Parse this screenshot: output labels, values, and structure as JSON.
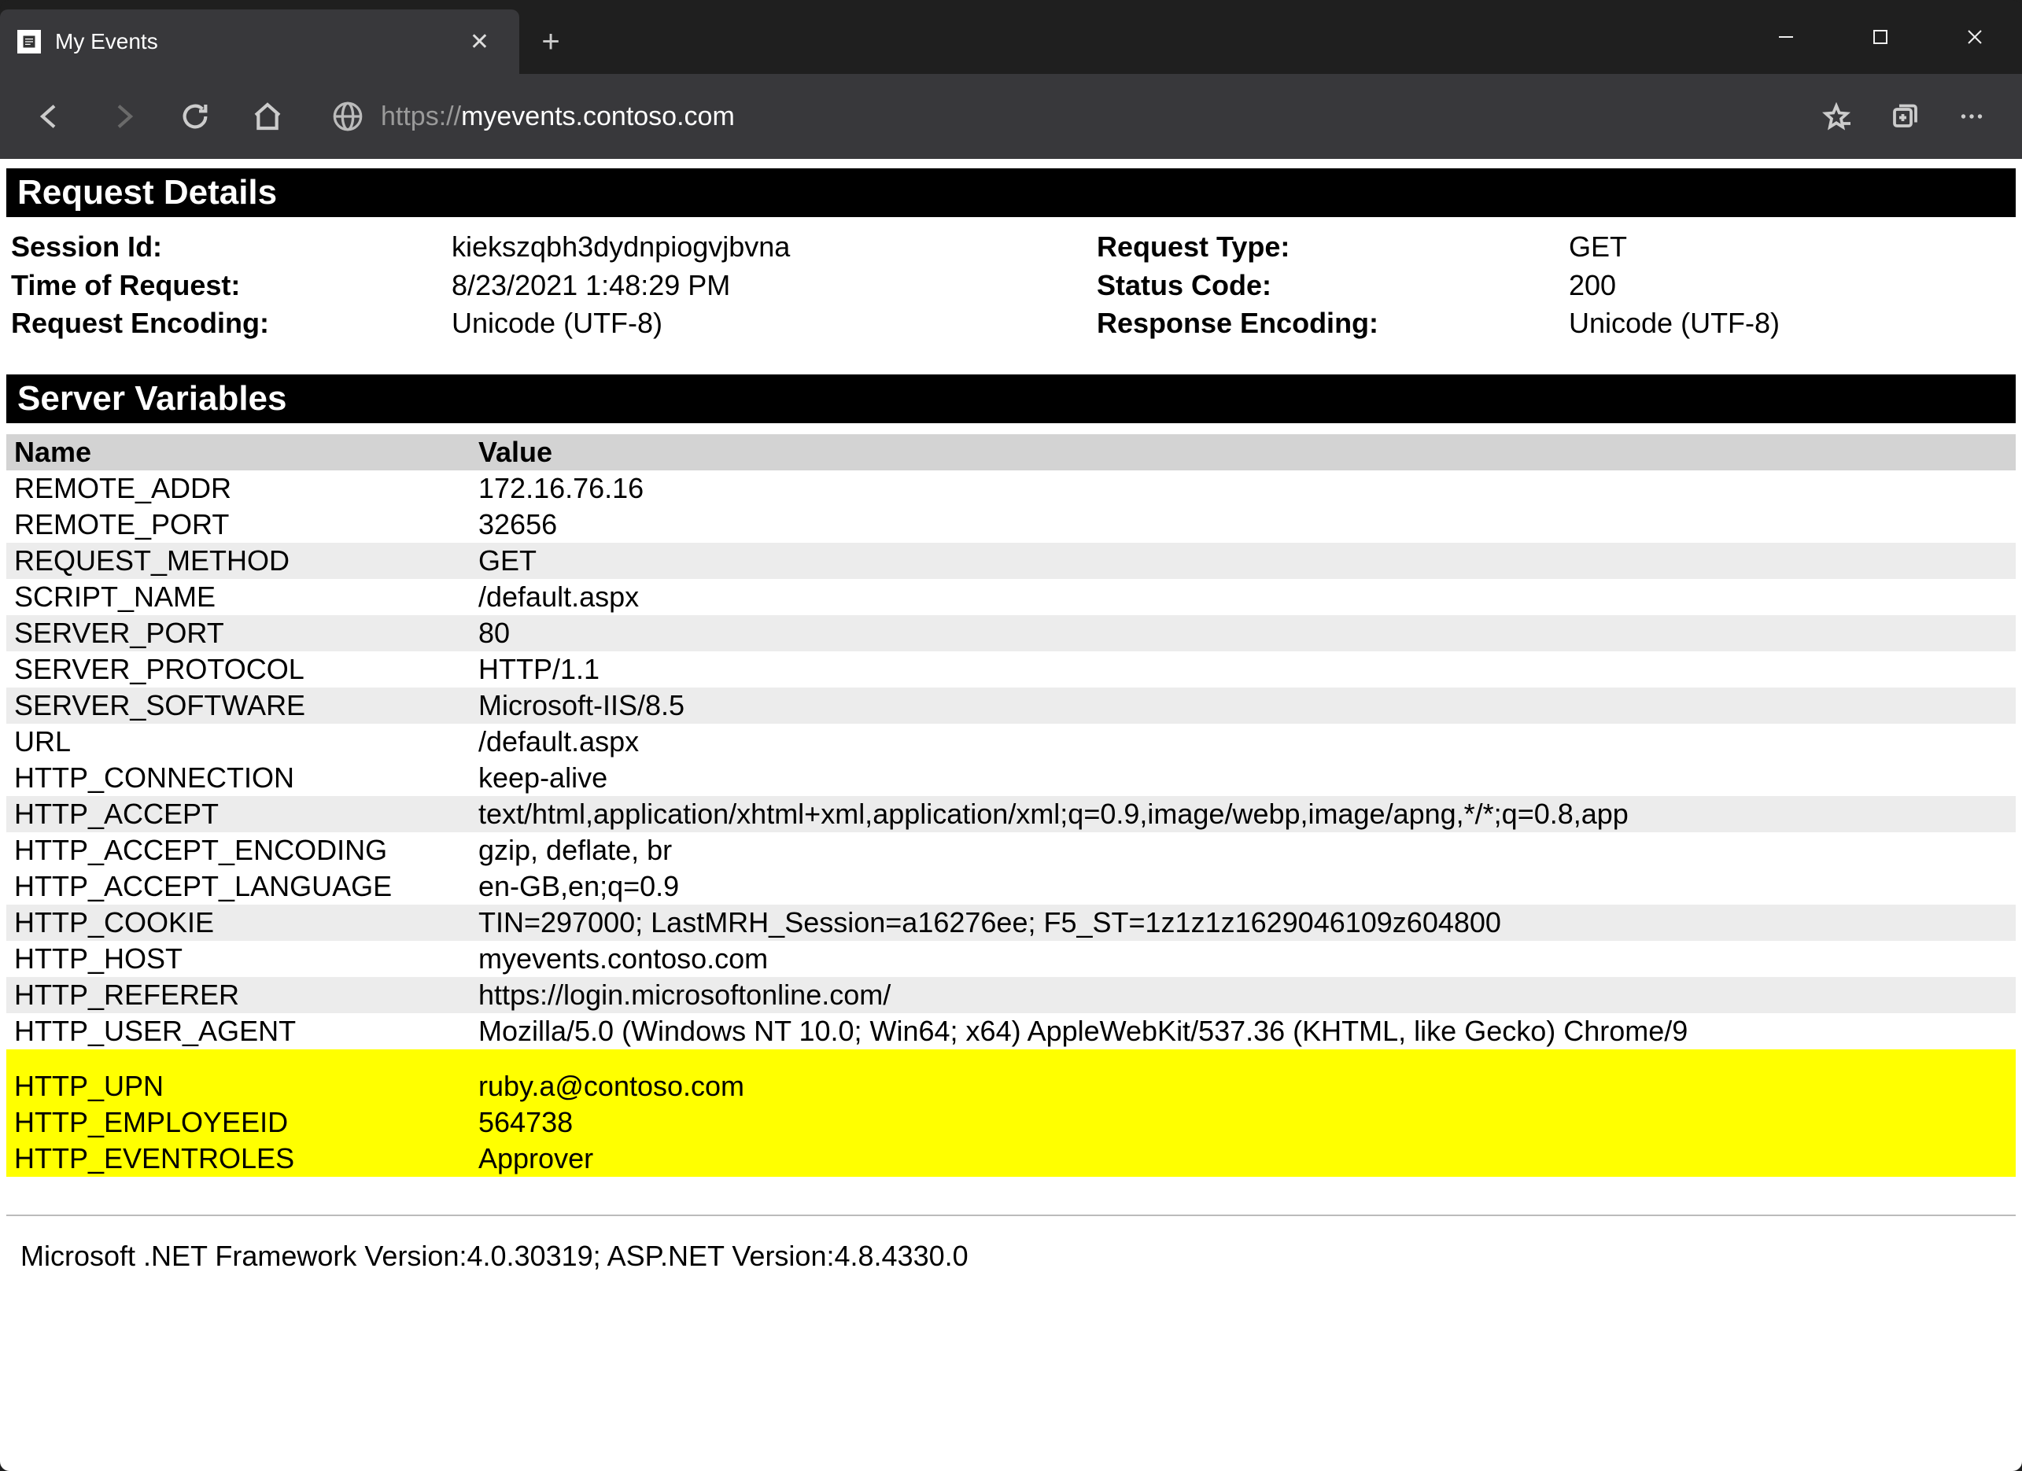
{
  "browser": {
    "tab_title": "My Events",
    "url_proto": "https://",
    "url_rest": "myevents.contoso.com"
  },
  "page": {
    "section_details": "Request Details",
    "section_vars": "Server Variables",
    "details": {
      "session_id_label": "Session Id:",
      "session_id": "kiekszqbh3dydnpiogvjbvna",
      "request_type_label": "Request Type:",
      "request_type": "GET",
      "time_label": "Time of Request:",
      "time": "8/23/2021 1:48:29 PM",
      "status_label": "Status Code:",
      "status": "200",
      "req_enc_label": "Request Encoding:",
      "req_enc": "Unicode (UTF-8)",
      "resp_enc_label": "Response Encoding:",
      "resp_enc": "Unicode (UTF-8)"
    },
    "vars_header_name": "Name",
    "vars_header_value": "Value",
    "vars": [
      {
        "name": "REMOTE_ADDR",
        "value": "172.16.76.16",
        "alt": false,
        "hl": false,
        "gap": false
      },
      {
        "name": "REMOTE_PORT",
        "value": "32656",
        "alt": false,
        "hl": false,
        "gap": false
      },
      {
        "name": "REQUEST_METHOD",
        "value": "GET",
        "alt": true,
        "hl": false,
        "gap": false
      },
      {
        "name": "SCRIPT_NAME",
        "value": "/default.aspx",
        "alt": false,
        "hl": false,
        "gap": false
      },
      {
        "name": "SERVER_PORT",
        "value": "80",
        "alt": true,
        "hl": false,
        "gap": false
      },
      {
        "name": "SERVER_PROTOCOL",
        "value": "HTTP/1.1",
        "alt": false,
        "hl": false,
        "gap": false
      },
      {
        "name": "SERVER_SOFTWARE",
        "value": "Microsoft-IIS/8.5",
        "alt": true,
        "hl": false,
        "gap": false
      },
      {
        "name": "URL",
        "value": "/default.aspx",
        "alt": false,
        "hl": false,
        "gap": false
      },
      {
        "name": "HTTP_CONNECTION",
        "value": "keep-alive",
        "alt": false,
        "hl": false,
        "gap": false
      },
      {
        "name": "HTTP_ACCEPT",
        "value": "text/html,application/xhtml+xml,application/xml;q=0.9,image/webp,image/apng,*/*;q=0.8,app",
        "alt": true,
        "hl": false,
        "gap": false
      },
      {
        "name": "HTTP_ACCEPT_ENCODING",
        "value": "gzip, deflate, br",
        "alt": false,
        "hl": false,
        "gap": false
      },
      {
        "name": "HTTP_ACCEPT_LANGUAGE",
        "value": "en-GB,en;q=0.9",
        "alt": false,
        "hl": false,
        "gap": false
      },
      {
        "name": "HTTP_COOKIE",
        "value": "TIN=297000; LastMRH_Session=a16276ee; F5_ST=1z1z1z1629046109z604800",
        "alt": true,
        "hl": false,
        "gap": false
      },
      {
        "name": "HTTP_HOST",
        "value": "myevents.contoso.com",
        "alt": false,
        "hl": false,
        "gap": false
      },
      {
        "name": "HTTP_REFERER",
        "value": "https://login.microsoftonline.com/",
        "alt": true,
        "hl": false,
        "gap": false
      },
      {
        "name": "HTTP_USER_AGENT",
        "value": "Mozilla/5.0 (Windows NT 10.0; Win64; x64) AppleWebKit/537.36 (KHTML, like Gecko) Chrome/9",
        "alt": false,
        "hl": false,
        "gap": false
      },
      {
        "name": "HTTP_UPN",
        "value": "ruby.a@contoso.com",
        "alt": false,
        "hl": true,
        "gap": true
      },
      {
        "name": "HTTP_EMPLOYEEID",
        "value": "564738",
        "alt": false,
        "hl": true,
        "gap": false
      },
      {
        "name": "HTTP_EVENTROLES",
        "value": "Approver",
        "alt": false,
        "hl": true,
        "gap": false
      }
    ],
    "footer": "Microsoft .NET Framework Version:4.0.30319; ASP.NET Version:4.8.4330.0"
  }
}
